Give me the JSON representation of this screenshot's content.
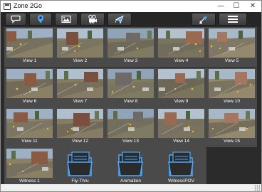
{
  "window": {
    "title": "Zone 2Go",
    "minimize_glyph": "—",
    "maximize_glyph": "☐",
    "close_glyph": "✕"
  },
  "toolbar": {
    "buttons": [
      {
        "icon": "speech-bubble-icon"
      },
      {
        "icon": "location-pin-icon"
      },
      {
        "icon": "image-icon"
      },
      {
        "icon": "video-camera-icon"
      },
      {
        "icon": "navigate-arrow-icon"
      },
      {
        "icon": "satellite-dish-icon"
      },
      {
        "icon": "hamburger-menu-icon"
      }
    ]
  },
  "colors": {
    "toolbar_bg": "#262626",
    "content_bg": "#2b2b2b",
    "tile_bg": "#4a4a4a",
    "accent_blue": "#4aa8ff",
    "label": "#ffffff"
  },
  "tiles": [
    {
      "label": "View 1",
      "kind": "view"
    },
    {
      "label": "View 2",
      "kind": "view"
    },
    {
      "label": "View 3",
      "kind": "view"
    },
    {
      "label": "View 4",
      "kind": "view"
    },
    {
      "label": "View 5",
      "kind": "view"
    },
    {
      "label": "View 6",
      "kind": "view"
    },
    {
      "label": "View 7",
      "kind": "view"
    },
    {
      "label": "View 8",
      "kind": "view"
    },
    {
      "label": "View 9",
      "kind": "view"
    },
    {
      "label": "View 10",
      "kind": "view"
    },
    {
      "label": "View 11",
      "kind": "view"
    },
    {
      "label": "View 12",
      "kind": "view"
    },
    {
      "label": "View 13",
      "kind": "view"
    },
    {
      "label": "View 14",
      "kind": "view"
    },
    {
      "label": "View 15",
      "kind": "view"
    },
    {
      "label": "Witness 1",
      "kind": "view"
    },
    {
      "label": "Fly-Thru",
      "kind": "folder"
    },
    {
      "label": "Animation",
      "kind": "folder"
    },
    {
      "label": "WitnessPOV",
      "kind": "folder"
    }
  ]
}
